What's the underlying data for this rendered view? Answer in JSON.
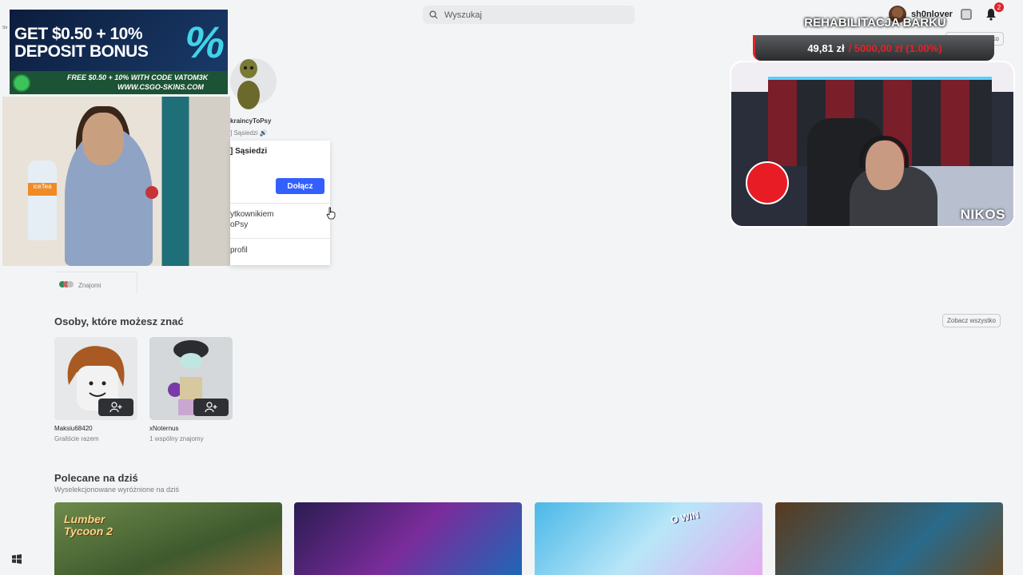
{
  "header": {
    "search_placeholder": "Wyszukaj",
    "username": "sh0nlover",
    "notification_count": "2",
    "side_label": "Str"
  },
  "ad": {
    "headline_1": "GET $0.50 + 10%",
    "headline_2": "DEPOSIT BONUS",
    "percent": "%",
    "promo_1": "FREE $0.50 + 10% WITH CODE VATOM3K",
    "promo_2": "WWW.CSGO-SKINS.COM"
  },
  "webcam_left": {
    "bottle_label": "iceTea"
  },
  "group": {
    "name": "kraincyToPsy",
    "subtitle": "] Sąsiedzi 🔊"
  },
  "popup": {
    "title": "] Sąsiedzi",
    "join_label": "Dołącz",
    "chat_line1": "ytkownikiem",
    "chat_line2": "oPsy",
    "profile_label": "profil"
  },
  "friends_section": {
    "row_label": "Znajomi",
    "see_all_top": "Zobacz wszystko"
  },
  "people": {
    "title": "Osoby, które możesz znać",
    "see_all": "Zobacz wszystko",
    "items": [
      {
        "name": "Maksiu68420",
        "subtitle": "Graliście razem"
      },
      {
        "name": "xNoternus",
        "subtitle": "1 wspólny znajomy"
      }
    ]
  },
  "recommended": {
    "title": "Polecane na dziś",
    "subtitle": "Wyselekcjonowane wyróżnione na dziś",
    "tiles": [
      {
        "text": "Lumber Tycoon 2"
      },
      {
        "text": ""
      },
      {
        "text": "O WIN"
      },
      {
        "text": ""
      }
    ]
  },
  "stream_overlay": {
    "goal_title": "REHABILITACJA BARKU",
    "goal_current": "49,81 zł",
    "goal_rest": "/ 5000,00 zł (1.00%)",
    "progress_fraction": 0.01,
    "streamer_logo": "NIKOS"
  },
  "colors": {
    "accent_blue": "#335fff",
    "goal_red": "#e0232a",
    "background": "#f2f4f5"
  }
}
